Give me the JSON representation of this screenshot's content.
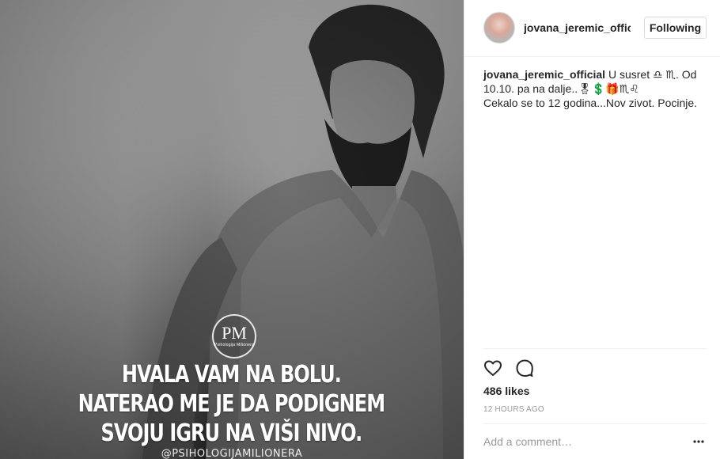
{
  "post": {
    "image": {
      "logo_monogram": "PM",
      "logo_subtitle": "Psihologija Milionera",
      "quote_lines": [
        "HVALA VAM NA BOLU.",
        "NATERAO ME JE DA PODIGNEM",
        "SVOJU IGRU NA VIŠI NIVO."
      ],
      "watermark": "@PSIHOLOGIJAMILIONERA"
    },
    "header": {
      "username": "jovana_jeremic_official",
      "follow_label": "Following"
    },
    "caption": {
      "username": "jovana_jeremic_official",
      "text": "U susret ♎ ♏. Od 10.10. pa na dalje..🎖💲🎁♏♌\nCekalo se to 12 godina...Nov zivot. Pocinje."
    },
    "actions": {
      "like_icon": "heart-icon",
      "comment_icon": "comment-bubble-icon"
    },
    "likes_label": "486 likes",
    "timestamp": "12 HOURS AGO",
    "comment": {
      "placeholder": "Add a comment…",
      "more_icon": "ellipsis-icon"
    }
  },
  "colors": {
    "text": "#262626",
    "muted": "#999999",
    "border": "#efefef"
  }
}
